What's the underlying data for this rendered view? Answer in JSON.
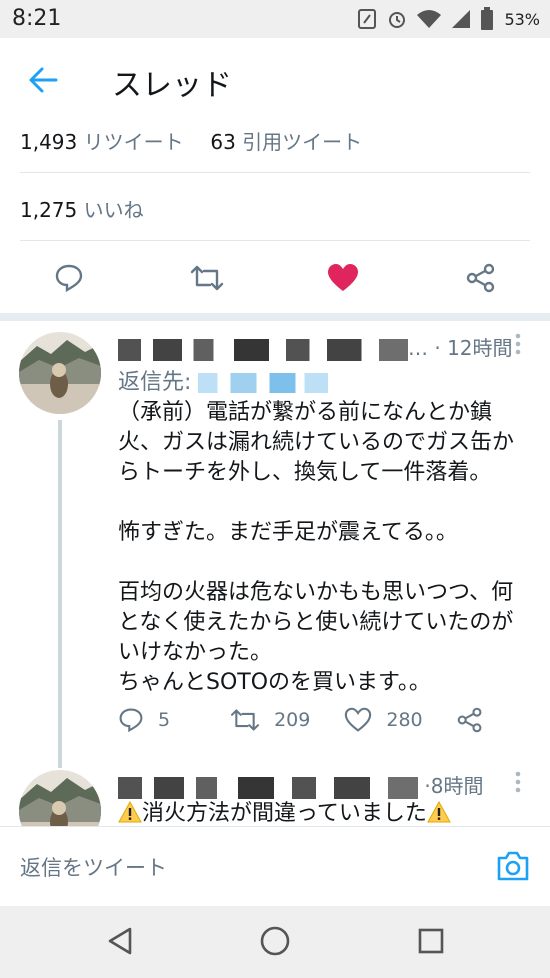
{
  "status_bar": {
    "time": "8:21",
    "battery_pct": "53%"
  },
  "header": {
    "title": "スレッド"
  },
  "stats": {
    "retweets_count": "1,493",
    "retweets_label": "リツイート",
    "quotes_count": "63",
    "quotes_label": "引用ツイート",
    "likes_count": "1,275",
    "likes_label": "いいね"
  },
  "reply_1": {
    "name_suffix": "…",
    "time": "· 12時間",
    "reply_to_label": "返信先:",
    "body": "（承前）電話が繋がる前になんとか鎮\n火、ガスは漏れ続けているのでガス缶か\nらトーチを外し、換気して一件落着。\n\n怖すぎた。まだ手足が震えてる。。\n\n百均の火器は危ないかもも思いつつ、何\nとなく使えたからと使い続けていたのが\nいけなかった。\nちゃんとSOTOのを買います。。",
    "reply_count": "5",
    "retweet_count": "209",
    "like_count": "280"
  },
  "reply_2": {
    "name_suffix": "·",
    "time": "8時間",
    "body": "消火方法が間違っていました"
  },
  "reply_bar": {
    "placeholder": "返信をツイート"
  },
  "colors": {
    "accent": "#1da1f2",
    "like": "#e0245e",
    "muted": "#657786"
  }
}
